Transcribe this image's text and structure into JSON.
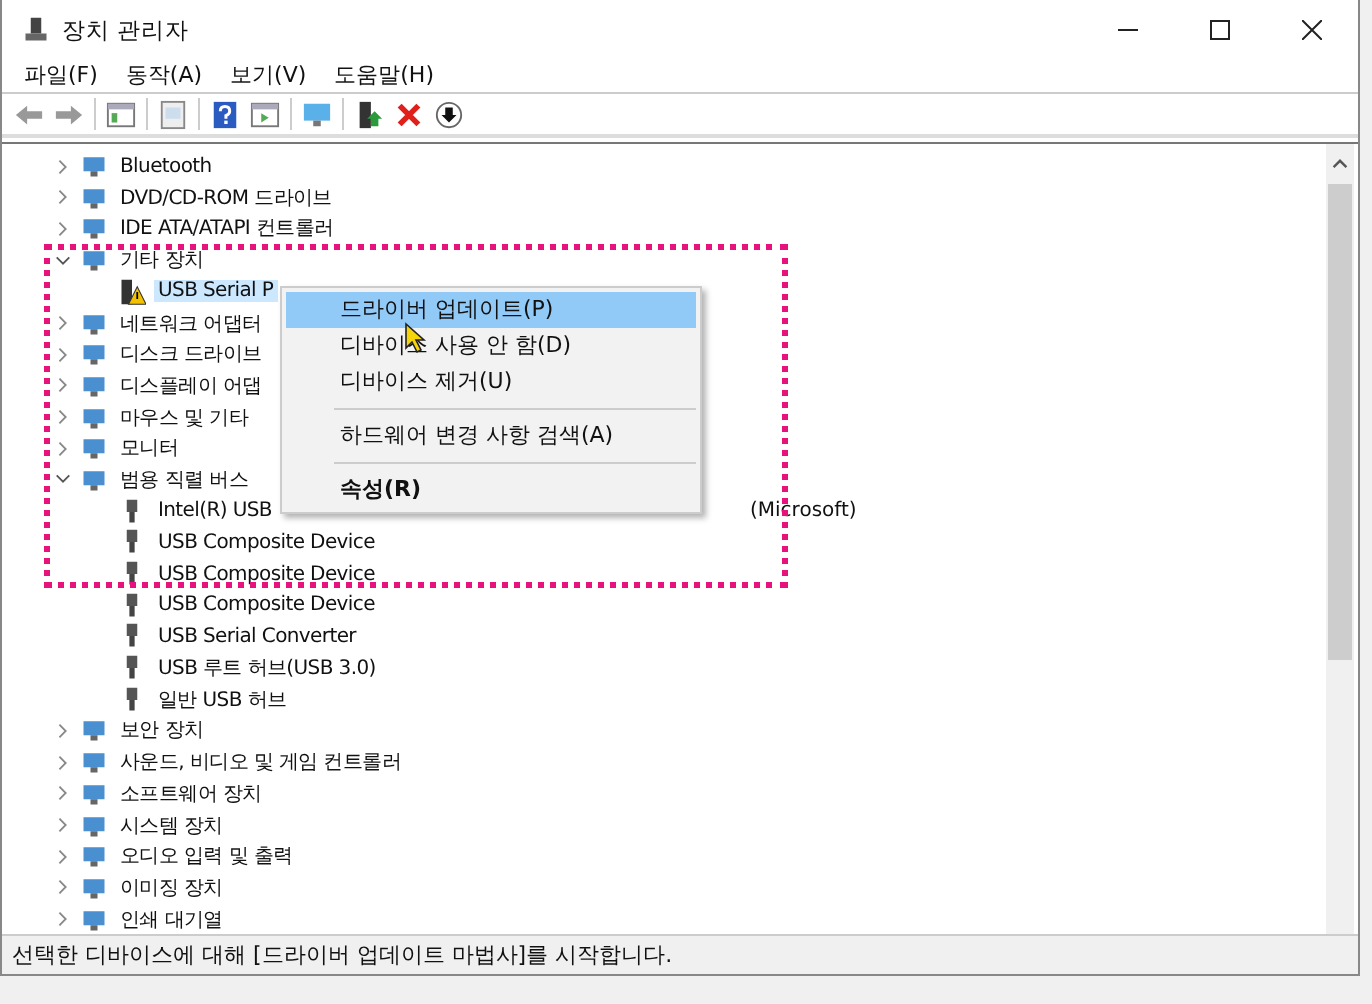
{
  "window": {
    "title": "장치 관리자"
  },
  "menu_bar": [
    "파일(F)",
    "동작(A)",
    "보기(V)",
    "도움말(H)"
  ],
  "tree": [
    {
      "label": "Bluetooth",
      "expanded": false
    },
    {
      "label": "DVD/CD-ROM 드라이브",
      "expanded": false
    },
    {
      "label": "IDE ATA/ATAPI 컨트롤러",
      "expanded": false
    },
    {
      "label": "기타 장치",
      "expanded": true,
      "children": [
        {
          "label": "USB Serial P",
          "warning": true,
          "selected": true
        }
      ]
    },
    {
      "label": "네트워크 어댑터",
      "expanded": false
    },
    {
      "label": "디스크 드라이브",
      "expanded": false
    },
    {
      "label": "디스플레이 어댑",
      "expanded": false
    },
    {
      "label": "마우스 및 기타",
      "expanded": false
    },
    {
      "label": "모니터",
      "expanded": false
    },
    {
      "label": "범용 직렬 버스",
      "expanded": true,
      "children": [
        {
          "label": "Intel(R) USB",
          "tail": "(Microsoft)",
          "warning": false,
          "selected": false
        },
        {
          "label": "USB Composite Device",
          "warning": false,
          "selected": false
        },
        {
          "label": "USB Composite Device",
          "warning": false,
          "selected": false
        },
        {
          "label": "USB Composite Device",
          "warning": false,
          "selected": false
        },
        {
          "label": "USB Serial Converter",
          "warning": false,
          "selected": false
        },
        {
          "label": "USB 루트 허브(USB 3.0)",
          "warning": false,
          "selected": false
        },
        {
          "label": "일반 USB 허브",
          "warning": false,
          "selected": false
        }
      ]
    },
    {
      "label": "보안 장치",
      "expanded": false
    },
    {
      "label": "사운드, 비디오 및 게임 컨트롤러",
      "expanded": false
    },
    {
      "label": "소프트웨어 장치",
      "expanded": false
    },
    {
      "label": "시스템 장치",
      "expanded": false
    },
    {
      "label": "오디오 입력 및 출력",
      "expanded": false
    },
    {
      "label": "이미징 장치",
      "expanded": false
    },
    {
      "label": "인쇄 대기열",
      "expanded": false
    }
  ],
  "context_menu": [
    {
      "kind": "item",
      "label": "드라이버 업데이트(P)",
      "selected": true,
      "default": false
    },
    {
      "kind": "item",
      "label": "디바이스 사용 안 함(D)",
      "selected": false,
      "default": false
    },
    {
      "kind": "item",
      "label": "디바이스 제거(U)",
      "selected": false,
      "default": false
    },
    {
      "kind": "separator"
    },
    {
      "kind": "item",
      "label": "하드웨어 변경 사항 검색(A)",
      "selected": false,
      "default": false
    },
    {
      "kind": "separator"
    },
    {
      "kind": "item",
      "label": "속성(R)",
      "selected": false,
      "default": true
    }
  ],
  "status_bar": "선택한 디바이스에 대해 [드라이버 업데이트 마법사]를 시작합니다."
}
